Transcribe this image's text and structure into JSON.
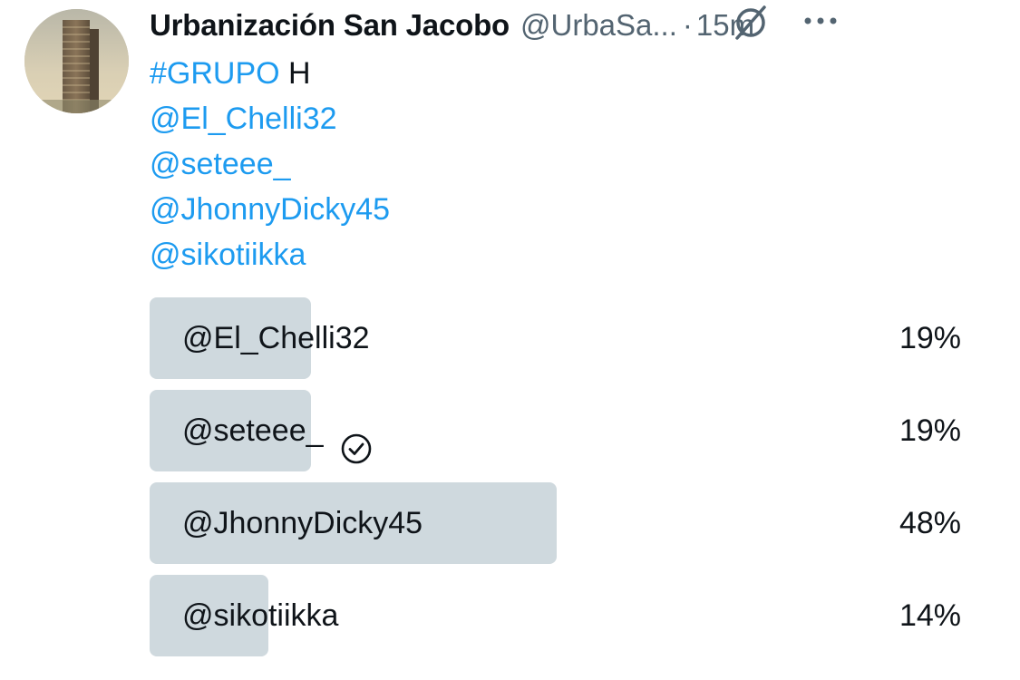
{
  "author": {
    "display_name": "Urbanización San Jacobo",
    "handle": "@UrbaSa...",
    "separator": "·",
    "time": "15m",
    "avatar_icon": "building-photo-avatar"
  },
  "icons": {
    "grok": "grok-slash-icon",
    "more": "more-dots-icon",
    "voted": "check-circle-icon"
  },
  "body": {
    "hashtag": "#GRUPO",
    "hashtag_suffix": " H",
    "mentions": [
      "@El_Chelli32",
      "@seteee_",
      "@JhonnyDicky45",
      "@sikotiikka"
    ]
  },
  "poll": {
    "options": [
      {
        "label": "@El_Chelli32",
        "percent_text": "19%",
        "percent": 19,
        "voted": false
      },
      {
        "label": "@seteee_",
        "percent_text": "19%",
        "percent": 19,
        "voted": true
      },
      {
        "label": "@JhonnyDicky45",
        "percent_text": "48%",
        "percent": 48,
        "voted": false
      },
      {
        "label": "@sikotiikka",
        "percent_text": "14%",
        "percent": 14,
        "voted": false
      }
    ]
  },
  "colors": {
    "link_blue": "#1d9bf0",
    "text": "#0f1419",
    "secondary": "#536471",
    "poll_bar": "#cfd9de"
  }
}
